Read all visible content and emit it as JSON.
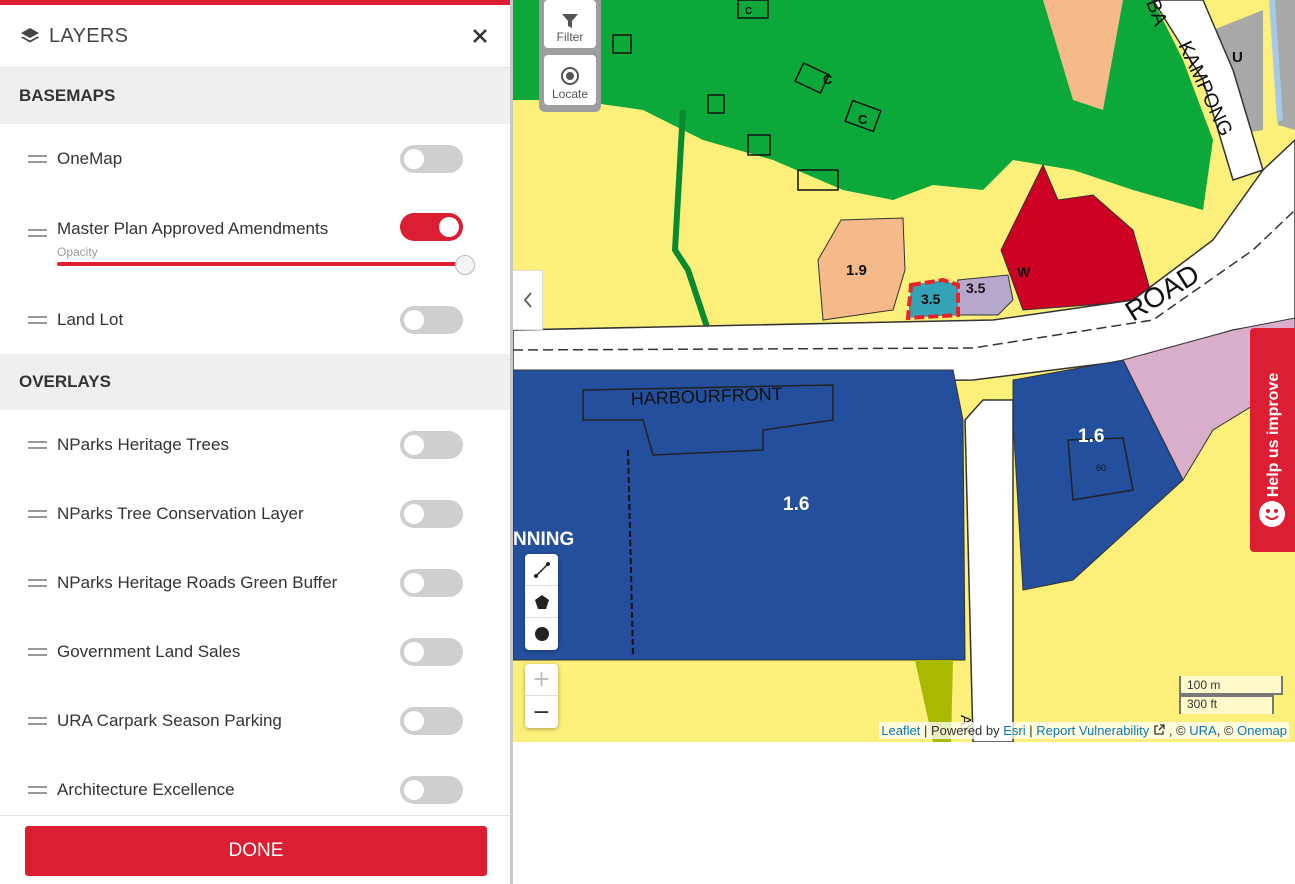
{
  "panel": {
    "title": "LAYERS",
    "title_icon": "layers-icon",
    "close_icon": "close-icon",
    "done_label": "DONE"
  },
  "sections": {
    "basemaps": {
      "heading": "BASEMAPS",
      "items": [
        {
          "label": "OneMap",
          "enabled": false
        },
        {
          "label": "Master Plan Approved Amendments",
          "enabled": true,
          "opacity_label": "Opacity",
          "opacity_percent": 100
        },
        {
          "label": "Land Lot",
          "enabled": false
        }
      ]
    },
    "overlays": {
      "heading": "OVERLAYS",
      "items": [
        {
          "label": "NParks Heritage Trees",
          "enabled": false
        },
        {
          "label": "NParks Tree Conservation Layer",
          "enabled": false
        },
        {
          "label": "NParks Heritage Roads Green Buffer",
          "enabled": false
        },
        {
          "label": "Government Land Sales",
          "enabled": false
        },
        {
          "label": "URA Carpark Season Parking",
          "enabled": false
        },
        {
          "label": "Architecture Excellence",
          "enabled": false
        }
      ]
    }
  },
  "map": {
    "filter_label": "Filter",
    "locate_label": "Locate",
    "zoom_in": "+",
    "zoom_out": "−",
    "labels": {
      "c1": "C",
      "c2": "C",
      "c3": "C",
      "plot_19": "1.9",
      "plot_35a": "3.5",
      "plot_35b": "3.5",
      "w": "W",
      "u": "U",
      "road": "ROAD",
      "kampong": "KAMPONG",
      "ba": "BA",
      "harbourfront": "HARBOURFRONT",
      "plot_16a": "1.6",
      "plot_16b": "1.6",
      "bldg_60": "60",
      "nning": "NNING",
      "ay": "AY"
    },
    "scale_m": "100 m",
    "scale_ft": "300 ft",
    "help_label": "Help us improve",
    "attribution": {
      "leaflet": "Leaflet",
      "sep1": " | Powered by ",
      "esri": "Esri",
      "sep2": " | ",
      "report": "Report Vulnerability",
      "sep3": " , © ",
      "ura": "URA",
      "sep4": ", © ",
      "onemap": "Onemap"
    }
  },
  "colors": {
    "accent": "#dc1e33",
    "park_green": "#0ca83a",
    "open_yellow": "#fdf07a",
    "business_blue": "#244f9c",
    "commercial_red": "#cc0123",
    "residential_peach": "#f5b98a",
    "civic_lilac": "#b6a7cc",
    "pink": "#d8aecb",
    "grey": "#a8a8a8"
  }
}
